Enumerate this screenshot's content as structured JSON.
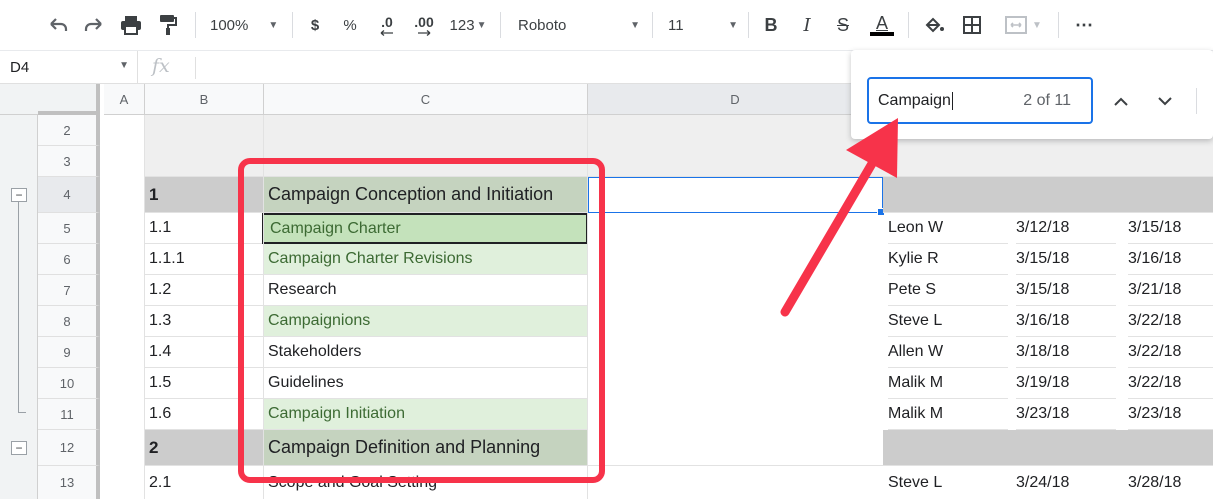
{
  "toolbar": {
    "zoom": "100%",
    "currency": "$",
    "percent": "%",
    "dec_less": ".0",
    "dec_more": ".00",
    "more_formats": "123",
    "font": "Roboto",
    "font_size": "11",
    "bold": "B",
    "italic": "I",
    "strike": "S",
    "text_color_glyph": "A",
    "more": "⋯"
  },
  "formula_bar": {
    "name_box": "D4",
    "fx": "fx"
  },
  "columns": [
    "A",
    "B",
    "C",
    "D"
  ],
  "rows": [
    {
      "num": "2",
      "b": "",
      "c": "",
      "name": "",
      "start": "",
      "end": ""
    },
    {
      "num": "3",
      "b": "",
      "c": "",
      "name": "",
      "start": "",
      "end": ""
    },
    {
      "num": "4",
      "b": "1",
      "c": "Campaign Conception and Initiation",
      "name": "",
      "start": "",
      "end": ""
    },
    {
      "num": "5",
      "b": "1.1",
      "c": "Campaign Charter",
      "name": "Leon W",
      "start": "3/12/18",
      "end": "3/15/18"
    },
    {
      "num": "6",
      "b": "1.1.1",
      "c": "Campaign Charter Revisions",
      "name": "Kylie R",
      "start": "3/15/18",
      "end": "3/16/18"
    },
    {
      "num": "7",
      "b": "1.2",
      "c": "Research",
      "name": "Pete S",
      "start": "3/15/18",
      "end": "3/21/18"
    },
    {
      "num": "8",
      "b": "1.3",
      "c": "Campaignions",
      "name": "Steve L",
      "start": "3/16/18",
      "end": "3/22/18"
    },
    {
      "num": "9",
      "b": "1.4",
      "c": "Stakeholders",
      "name": "Allen W",
      "start": "3/18/18",
      "end": "3/22/18"
    },
    {
      "num": "10",
      "b": "1.5",
      "c": "Guidelines",
      "name": "Malik M",
      "start": "3/19/18",
      "end": "3/22/18"
    },
    {
      "num": "11",
      "b": "1.6",
      "c": "Campaign Initiation",
      "name": "Malik M",
      "start": "3/23/18",
      "end": "3/23/18"
    },
    {
      "num": "12",
      "b": "2",
      "c": "Campaign Definition and Planning",
      "name": "",
      "start": "",
      "end": ""
    },
    {
      "num": "13",
      "b": "2.1",
      "c": "Scope and Goal Setting",
      "name": "Steve L",
      "start": "3/24/18",
      "end": "3/28/18"
    }
  ],
  "find": {
    "query": "Campaign",
    "count": "2 of 11"
  },
  "colors": {
    "highlight": "#e0f0dc",
    "current_match": "#c4e2bb",
    "header_band": "#cccccc",
    "annotation": "#f7334a",
    "selection": "#1a73e8"
  }
}
